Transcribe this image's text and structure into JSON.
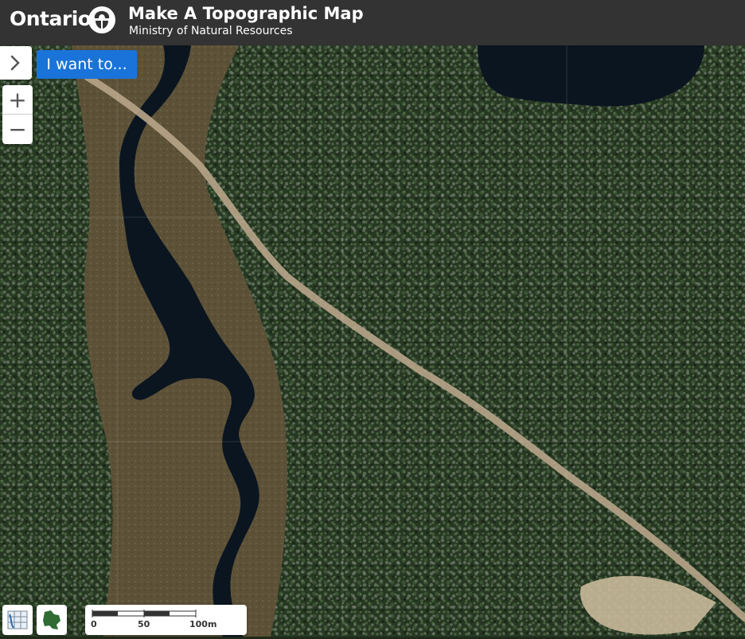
{
  "header": {
    "brand": "Ontario",
    "title": "Make A Topographic Map",
    "subtitle": "Ministry of Natural Resources"
  },
  "controls": {
    "i_want_to": "I want to...",
    "zoom_in": "+",
    "zoom_out": "−"
  },
  "scale_bar": {
    "labels": [
      "0",
      "50",
      "100m"
    ]
  },
  "icons": {
    "expand": "chevron-right-icon",
    "grid": "grid-map-icon",
    "province": "ontario-map-icon"
  },
  "colors": {
    "header_bg": "#333333",
    "button_blue": "#1a73d9",
    "water": "#0b1520",
    "forest": "#263822",
    "wetland": "#5d5238",
    "road": "#b8a58a"
  }
}
